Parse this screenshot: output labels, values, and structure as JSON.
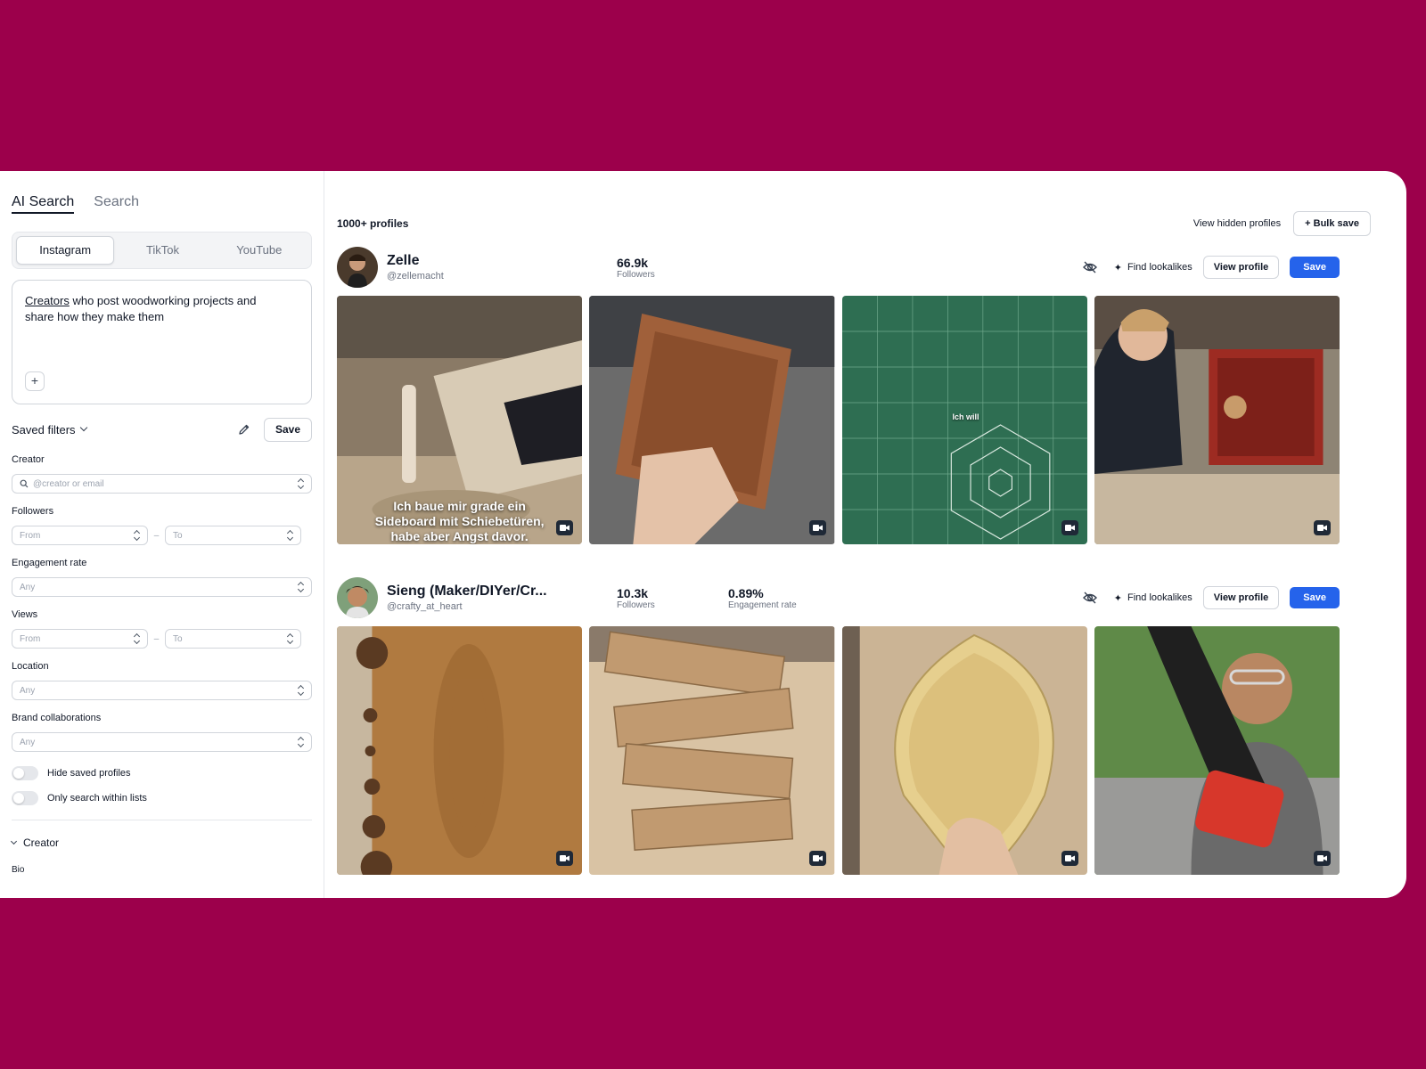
{
  "tabs": {
    "ai_search": "AI Search",
    "search": "Search"
  },
  "platforms": [
    "Instagram",
    "TikTok",
    "YouTube"
  ],
  "prompt": {
    "keyword": "Creators",
    "rest": " who post woodworking projects and share how they make them"
  },
  "saved_filters": {
    "label": "Saved filters",
    "save": "Save"
  },
  "filters": {
    "creator": {
      "label": "Creator",
      "placeholder": "@creator or email"
    },
    "followers": {
      "label": "Followers",
      "from": "From",
      "to": "To"
    },
    "engagement": {
      "label": "Engagement rate",
      "value": "Any"
    },
    "views": {
      "label": "Views",
      "from": "From",
      "to": "To"
    },
    "location": {
      "label": "Location",
      "value": "Any"
    },
    "brand": {
      "label": "Brand collaborations",
      "value": "Any"
    },
    "hide_saved": "Hide saved profiles",
    "only_lists": "Only search within lists",
    "section": "Creator",
    "bio": "Bio"
  },
  "results": {
    "count": "1000+ profiles",
    "view_hidden": "View hidden profiles",
    "bulk_save": "+ Bulk save"
  },
  "actions": {
    "lookalikes": "Find lookalikes",
    "view_profile": "View profile",
    "save": "Save"
  },
  "profiles": [
    {
      "name": "Zelle",
      "handle": "@zellemacht",
      "followers": "66.9k",
      "followers_label": "Followers",
      "thumb1_caption": "Ich baue mir grade ein Sideboard mit Schiebetüren, habe aber Angst davor.",
      "thumb3_caption": "Ich will"
    },
    {
      "name": "Sieng (Maker/DIYer/Cr...",
      "handle": "@crafty_at_heart",
      "followers": "10.3k",
      "followers_label": "Followers",
      "engagement": "0.89%",
      "engagement_label": "Engagement rate"
    }
  ],
  "colors": {
    "background": "#9c004b",
    "accent": "#2563eb"
  },
  "icons": [
    "search-icon",
    "pencil-icon",
    "eye-off-icon",
    "sparkle-icon",
    "video-icon",
    "chevron-down-icon",
    "plus-icon"
  ]
}
